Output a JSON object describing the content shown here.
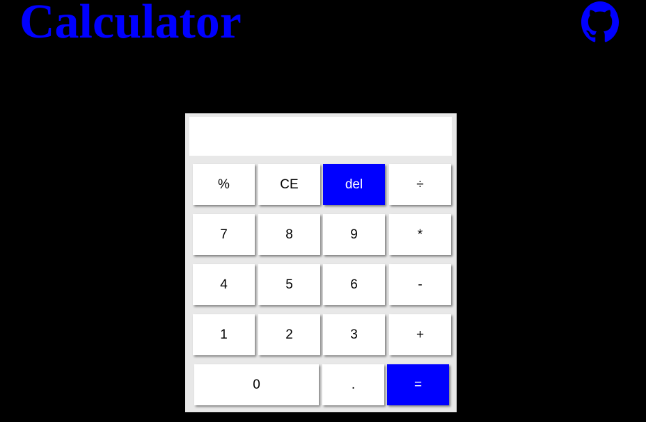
{
  "header": {
    "title": "Calculator",
    "github_icon": "github-icon",
    "accent_color": "#0000ff"
  },
  "calculator": {
    "display_value": "",
    "keys": {
      "percent": "%",
      "clear_entry": "CE",
      "delete": "del",
      "divide": "÷",
      "seven": "7",
      "eight": "8",
      "nine": "9",
      "multiply": "*",
      "four": "4",
      "five": "5",
      "six": "6",
      "subtract": "-",
      "one": "1",
      "two": "2",
      "three": "3",
      "add": "+",
      "zero": "0",
      "decimal": ".",
      "equals": "="
    },
    "highlight_color": "#0000ff",
    "panel_color": "#e8e8e8"
  }
}
